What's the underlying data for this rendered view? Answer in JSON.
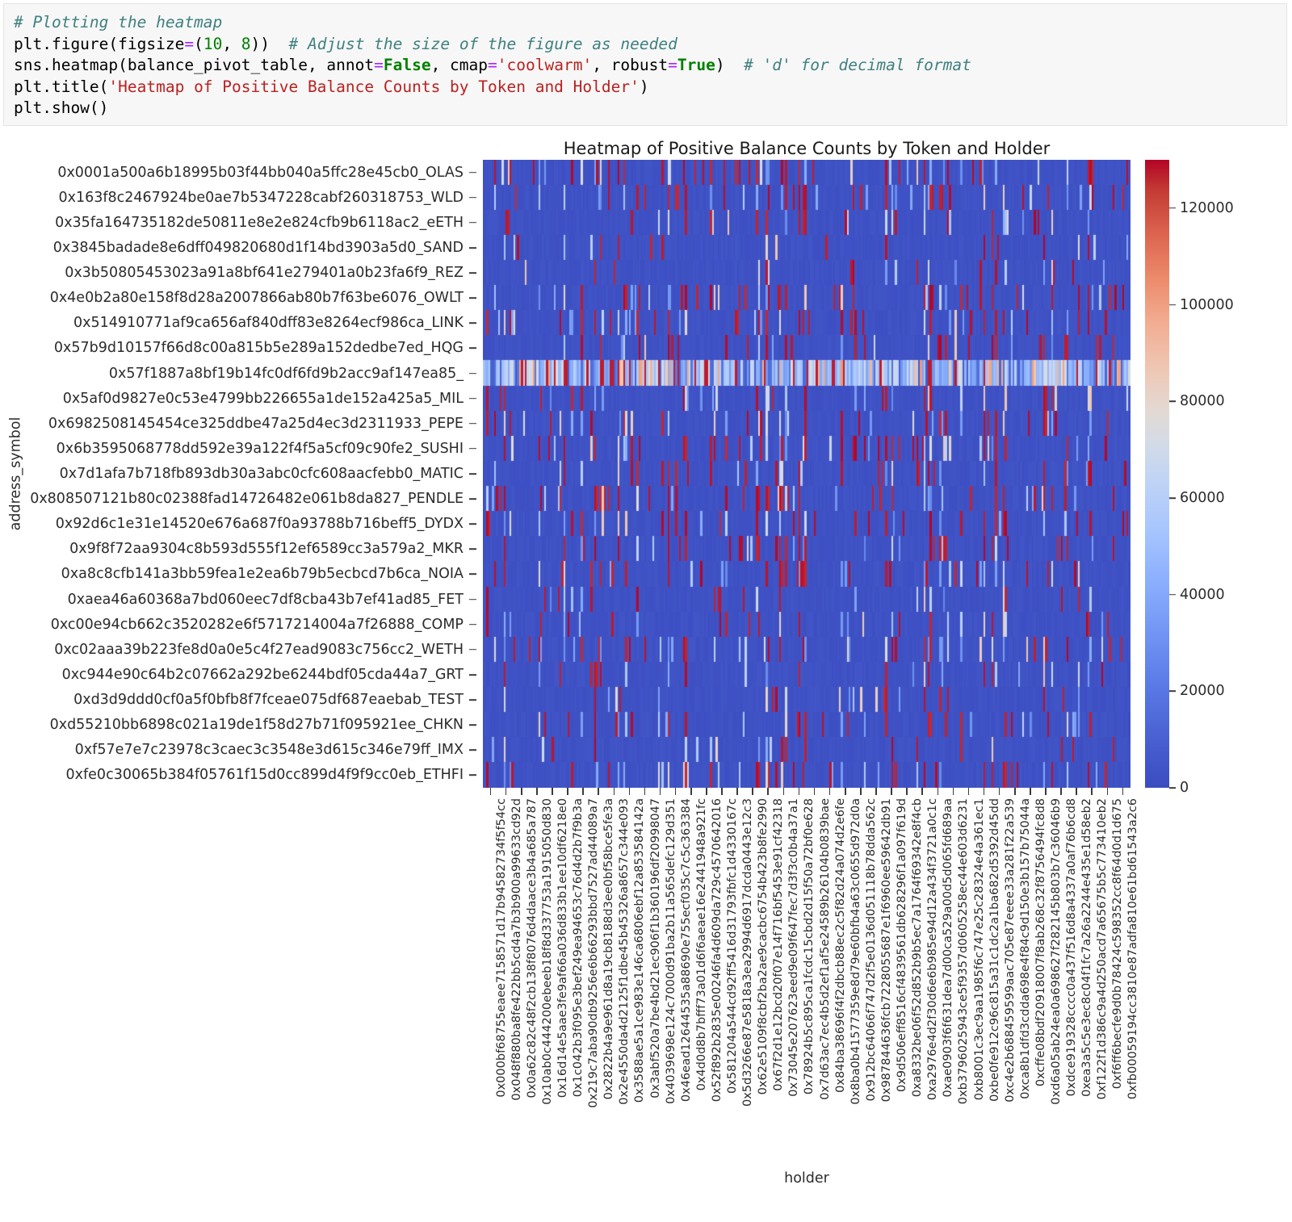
{
  "code_cell": {
    "lines": [
      [
        {
          "t": "# Plotting the heatmap",
          "c": "tok-comment"
        }
      ],
      [
        {
          "t": "plt.figure(figsize",
          "c": "tok-plain"
        },
        {
          "t": "=",
          "c": "tok-op"
        },
        {
          "t": "(",
          "c": "tok-plain"
        },
        {
          "t": "10",
          "c": "tok-num"
        },
        {
          "t": ", ",
          "c": "tok-plain"
        },
        {
          "t": "8",
          "c": "tok-num"
        },
        {
          "t": "))  ",
          "c": "tok-plain"
        },
        {
          "t": "# Adjust the size of the figure as needed",
          "c": "tok-comment"
        }
      ],
      [
        {
          "t": "sns.heatmap(balance_pivot_table, annot",
          "c": "tok-plain"
        },
        {
          "t": "=",
          "c": "tok-op"
        },
        {
          "t": "False",
          "c": "tok-kw"
        },
        {
          "t": ", cmap",
          "c": "tok-plain"
        },
        {
          "t": "=",
          "c": "tok-op"
        },
        {
          "t": "'coolwarm'",
          "c": "tok-str"
        },
        {
          "t": ", robust",
          "c": "tok-plain"
        },
        {
          "t": "=",
          "c": "tok-op"
        },
        {
          "t": "True",
          "c": "tok-kw"
        },
        {
          "t": ")  ",
          "c": "tok-plain"
        },
        {
          "t": "# 'd' for decimal format",
          "c": "tok-comment"
        }
      ],
      [
        {
          "t": "plt.title(",
          "c": "tok-plain"
        },
        {
          "t": "'Heatmap of Positive Balance Counts by Token and Holder'",
          "c": "tok-str"
        },
        {
          "t": ")",
          "c": "tok-plain"
        }
      ],
      [
        {
          "t": "plt.show()",
          "c": "tok-plain"
        }
      ]
    ]
  },
  "chart_data": {
    "type": "heatmap",
    "title": "Heatmap of Positive Balance Counts by Token and Holder",
    "xlabel": "holder",
    "ylabel": "address_symbol",
    "cmap": "coolwarm",
    "robust": true,
    "annot": false,
    "figsize": [
      10,
      8
    ],
    "grid": false,
    "legend_position": "right",
    "colorbar": {
      "ticks": [
        0,
        20000,
        40000,
        60000,
        80000,
        100000,
        120000
      ],
      "tick_labels": [
        "0",
        "20000",
        "40000",
        "60000",
        "80000",
        "100000",
        "120000"
      ],
      "vmin": 0,
      "vmax": 130000,
      "low_color": "#3b4cc0",
      "mid_color": "#dddddd",
      "high_color": "#b40426"
    },
    "y_categories": [
      "0x0001a500a6b18995b03f44bb040a5ffc28e45cb0_OLAS",
      "0x163f8c2467924be0ae7b5347228cabf260318753_WLD",
      "0x35fa164735182de50811e8e2e824cfb9b6118ac2_eETH",
      "0x3845badade8e6dff049820680d1f14bd3903a5d0_SAND",
      "0x3b50805453023a91a8bf641e279401a0b23fa6f9_REZ",
      "0x4e0b2a80e158f8d28a2007866ab80b7f63be6076_OWLT",
      "0x514910771af9ca656af840dff83e8264ecf986ca_LINK",
      "0x57b9d10157f66d8c00a815b5e289a152dedbe7ed_HQG",
      "0x57f1887a8bf19b14fc0df6fd9b2acc9af147ea85_",
      "0x5af0d9827e0c53e4799bb226655a1de152a425a5_MIL",
      "0x6982508145454ce325ddbe47a25d4ec3d2311933_PEPE",
      "0x6b3595068778dd592e39a122f4f5a5cf09c90fe2_SUSHI",
      "0x7d1afa7b718fb893db30a3abc0cfc608aacfebb0_MATIC",
      "0x808507121b80c02388fad14726482e061b8da827_PENDLE",
      "0x92d6c1e31e14520e676a687f0a93788b716beff5_DYDX",
      "0x9f8f72aa9304c8b593d555f12ef6589cc3a579a2_MKR",
      "0xa8c8cfb141a3bb59fea1e2ea6b79b5ecbcd7b6ca_NOIA",
      "0xaea46a60368a7bd060eec7df8cba43b7ef41ad85_FET",
      "0xc00e94cb662c3520282e6f5717214004a7f26888_COMP",
      "0xc02aaa39b223fe8d0a0e5c4f27ead9083c756cc2_WETH",
      "0xc944e90c64b2c07662a292be6244bdf05cda44a7_GRT",
      "0xd3d9ddd0cf0a5f0bfb8f7fceae075df687eaebab_TEST",
      "0xd55210bb6898c021a19de1f58d27b71f095921ee_CHKN",
      "0xf57e7e7c23978c3caec3c3548e3d615c346e79ff_IMX",
      "0xfe0c30065b384f05761f15d0cc899d4f9f9cc0eb_ETHFI"
    ],
    "x_categories": [
      "0x000bf68755eaee7158571d17b945827 34f5f54cc",
      "0x048f880ba8fe422bb5cd4a7b3b900a99633cd92d",
      "0x0a62c82c48f2cb138f8076d4daace3b4a685a787",
      "0x10ab0c44420 0ebeeb18f8d337753a191505 0d830",
      "0x16d14e5aae3fe9af66a036d833b1ee10df6218e0",
      "0x1c042b3f095e3bef249ea94653c76d4d2b7f9b3a",
      "0x219c7aba90db9256e6b66293bbd7527ad44089a7",
      "0x2822b4a9e961d8a19cb8188d3ee0bf58bce5fe3a",
      "0x2e4550da4d2125f1dbe45b45326a8657c344e093",
      "0x3588ae5a1ce983e146ca6806ebf12a853584142a",
      "0x3abf520a7be4bd21ec906f1b360196df20998047",
      "0x4039698e124c7000d91ba2b11a565defc129d351",
      "0x46ead1264453 5a88690e755ecf035c7c5c363384",
      "0x4d0d8b7bfff73a01d6f6aeae16e2441948a921fc",
      "0x52f892b2835e00246fa4d609da729c457064 2016",
      "0x5812 04a544cd92ff5416d31793fbfc1d4330167c",
      "0x5d3266e87e5818a3ea2994d6917dcda0443e12c3",
      "0x62e5109f8cbf2ba2ae9cacbc6754b423b8fe2990",
      "0x67f2d1e12bcd20f07e14f716bf5453e91cf42318",
      "0x73045e207623eed9e09f647fec7d3f3c0b4a37a1",
      "0x78924b5c895ca1fcdc15cbd2d15f50a72bf0e628",
      "0x7d63ac7ec4b5d2ef1af5e24589b26104b0839bae",
      "0x84ba38696f4f2dbcb88ec2c5f82d24a074d2e6fe",
      "0x8ba0b41577359e8d79e60bfb4a63c0655d972d0a",
      "0x912bc64066f747d2f5e0136d051118b78dda562c",
      "0x987844636fcb7228055687e1f6960ee59642db91",
      "0x9d506eff8516cf4839561db628296f1a097f619d",
      "0xa8332be06f52d852b9b5ec7a1764f69342e8f4cb",
      "0xa2976e4d2f30d6e6b985e94d12a434f3721a0c1c",
      "0xae0903f6f631dea7d00ca529a00d5d065fd689aa",
      "0xb37960259 43ce5f9357d060 5258ec44e603d6231",
      "0xb8001c3ec9aa1985f6c747e25c28324e4a361ec1",
      "0xbe0fe912c96c815a31c1dc2a1ba682d5392d45dd",
      "0xc4e2b68845959 9aac705e87eeee33a281f22a539",
      "0xca8b1dfd3cdda698e4f84c9d150e3b157b75044a",
      "0xcffe08bdf20918007f8ab268c32f87564 94fc8d8",
      "0xd6a05ab24ea0a698627f282145b803b7c36046b9",
      "0xdce919328cccc0a437f516d8a4337a0af76b6cd8",
      "0xea3a5c5e3ec8c04f1fc7a26a2244e435e1d58eb2",
      "0xf122f1d386c9a4d250acd7a65675b5c773410eb2",
      "0xf6ff6becfe9d0b78424c598352cc8f64d0d1d675",
      "0xfb00059194cc3810e87adfa810e61bd61543a2c6"
    ],
    "notes": [
      "Dark blue (#3b4cc0) background dominates: most holder/token pairs have very low positive balance counts.",
      "Row index 8 (0x57f1887a8bf19b14fc0df6fd9b2acc9af147ea85_) is broadly light-blue/white with scattered reds across nearly all holders — the dominant token row.",
      "Vertical red streaks (values near and above 120000) appear sporadically across many tokens for a subset of holders."
    ]
  }
}
